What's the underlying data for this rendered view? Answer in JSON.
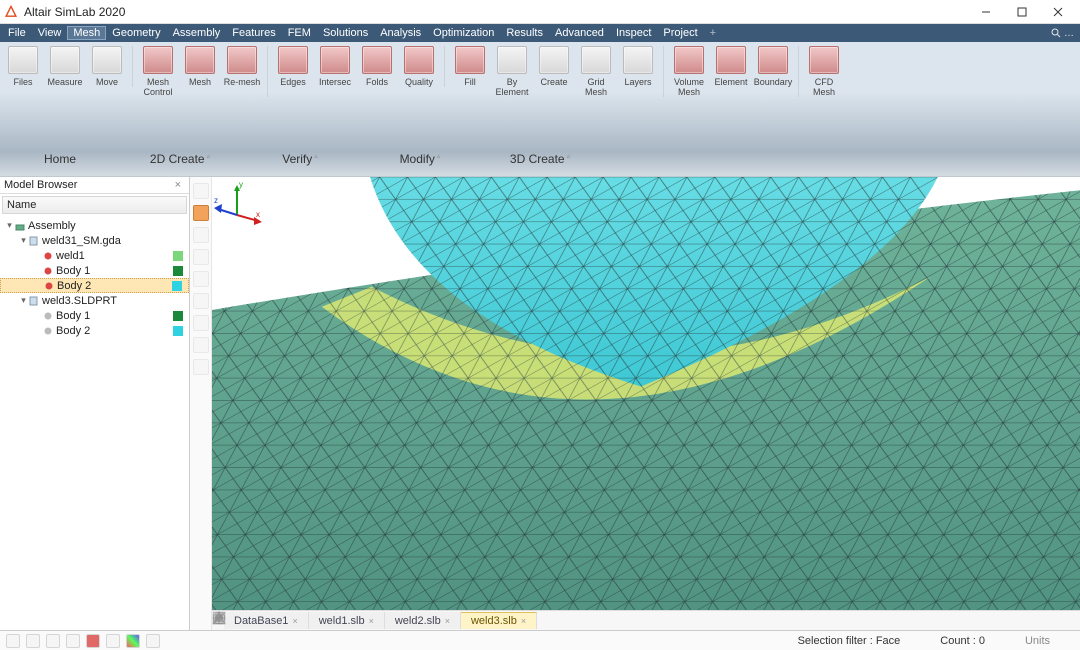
{
  "window": {
    "title": "Altair SimLab 2020"
  },
  "menu": {
    "items": [
      "File",
      "View",
      "Mesh",
      "Geometry",
      "Assembly",
      "Features",
      "FEM",
      "Solutions",
      "Analysis",
      "Optimization",
      "Results",
      "Advanced",
      "Inspect",
      "Project"
    ],
    "selected": "Mesh",
    "search_placeholder": "…"
  },
  "ribbon": {
    "groups": [
      {
        "buttons": [
          {
            "label": "Files",
            "icon": "gray"
          },
          {
            "label": "Measure",
            "icon": "gray"
          },
          {
            "label": "Move",
            "icon": "gray"
          }
        ]
      },
      {
        "buttons": [
          {
            "label": "Mesh Control",
            "icon": "red"
          },
          {
            "label": "Mesh",
            "icon": "red"
          },
          {
            "label": "Re-mesh",
            "icon": "red"
          }
        ]
      },
      {
        "buttons": [
          {
            "label": "Edges",
            "icon": "red"
          },
          {
            "label": "Intersec",
            "icon": "red"
          },
          {
            "label": "Folds",
            "icon": "red"
          },
          {
            "label": "Quality",
            "icon": "red"
          }
        ]
      },
      {
        "buttons": [
          {
            "label": "Fill",
            "icon": "red"
          },
          {
            "label": "By Element",
            "icon": "gray"
          },
          {
            "label": "Create",
            "icon": "gray"
          },
          {
            "label": "Grid Mesh",
            "icon": "gray"
          },
          {
            "label": "Layers",
            "icon": "gray"
          }
        ]
      },
      {
        "buttons": [
          {
            "label": "Volume Mesh",
            "icon": "red"
          },
          {
            "label": "Element",
            "icon": "red"
          },
          {
            "label": "Boundary",
            "icon": "red"
          }
        ]
      },
      {
        "buttons": [
          {
            "label": "CFD Mesh",
            "icon": "red"
          }
        ]
      }
    ],
    "tabs": [
      "Home",
      "2D Create",
      "Verify",
      "Modify",
      "3D Create"
    ]
  },
  "browser": {
    "title": "Model Browser",
    "column": "Name",
    "tree": [
      {
        "depth": 0,
        "exp": "-",
        "kind": "assembly",
        "label": "Assembly"
      },
      {
        "depth": 1,
        "exp": "-",
        "kind": "file",
        "label": "weld31_SM.gda"
      },
      {
        "depth": 2,
        "exp": "",
        "kind": "body-red",
        "label": "weld1",
        "swatch": "#7cd67c"
      },
      {
        "depth": 2,
        "exp": "",
        "kind": "body-red",
        "label": "Body 1",
        "swatch": "#1a8a3a"
      },
      {
        "depth": 2,
        "exp": "",
        "kind": "body-red",
        "label": "Body 2",
        "swatch": "#2fd2e0",
        "selected": true
      },
      {
        "depth": 1,
        "exp": "-",
        "kind": "file",
        "label": "weld3.SLDPRT"
      },
      {
        "depth": 2,
        "exp": "",
        "kind": "body-gray",
        "label": "Body 1",
        "swatch": "#1a8a3a"
      },
      {
        "depth": 2,
        "exp": "",
        "kind": "body-gray",
        "label": "Body 2",
        "swatch": "#2fd2e0"
      }
    ]
  },
  "doc_tabs": {
    "items": [
      "DataBase1",
      "weld1.slb",
      "weld2.slb",
      "weld3.slb"
    ],
    "active": "weld3.slb"
  },
  "status": {
    "filter_label": "Selection filter : Face",
    "count_label": "Count : 0",
    "units_label": "Units"
  },
  "triad": {
    "x": "x",
    "y": "y",
    "z": "z"
  }
}
